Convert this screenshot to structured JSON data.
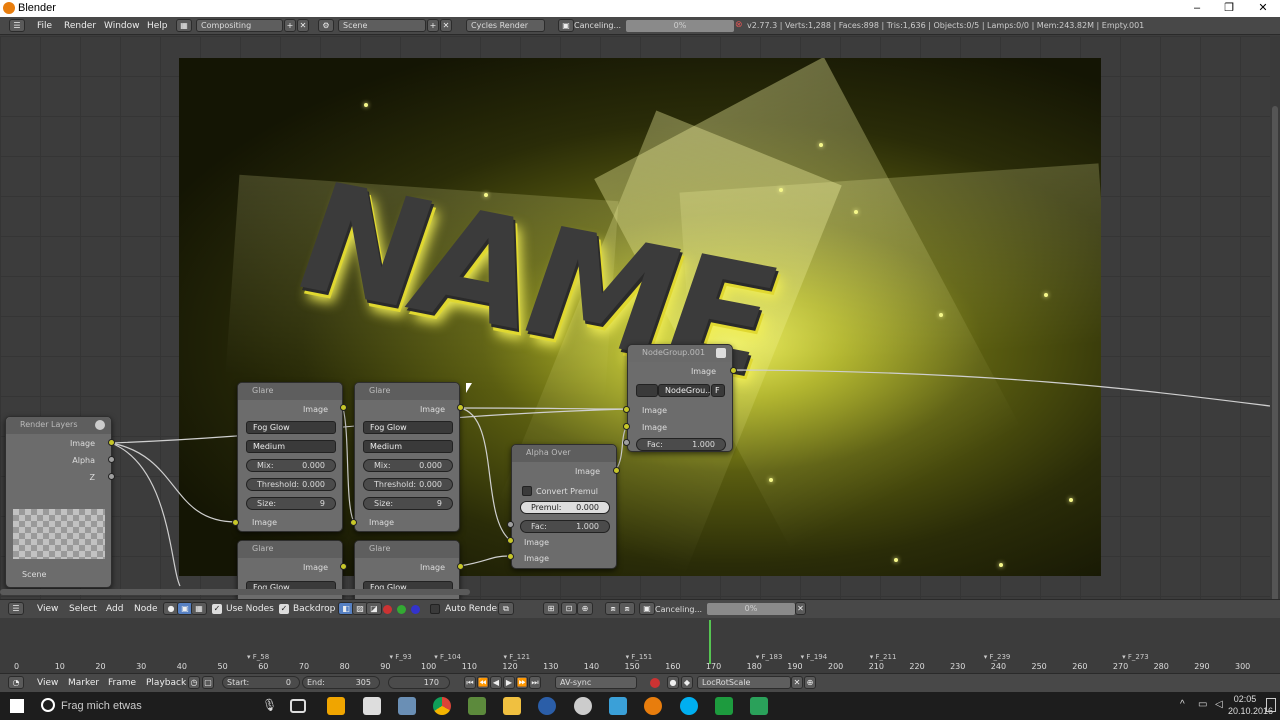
{
  "window": {
    "title": "Blender",
    "controls": [
      "–",
      "❐",
      "✕"
    ]
  },
  "info_header": {
    "menus": [
      "File",
      "Render",
      "Window",
      "Help"
    ],
    "screen_layout": "Compositing",
    "scene": "Scene",
    "engine": "Cycles Render",
    "job_label": "Canceling...",
    "progress_text": "0%",
    "progress_value": 0,
    "stats": "v2.77.3 | Verts:1,288 | Faces:898 | Tris:1,636 | Objects:0/5 | Lamps:0/0 | Mem:243.82M | Empty.001"
  },
  "backdrop": {
    "text": "NAME"
  },
  "nodes": {
    "render_layers": {
      "title": "Render Layers",
      "outputs": [
        "Image",
        "Alpha",
        "Z"
      ],
      "scene": "Scene"
    },
    "glare1": {
      "title": "Glare",
      "out": "Image",
      "type": "Fog Glow",
      "quality": "Medium",
      "mix_k": "Mix:",
      "mix_v": "0.000",
      "thr_k": "Threshold:",
      "thr_v": "0.000",
      "size_k": "Size:",
      "size_v": "9",
      "in": "Image"
    },
    "glare2": {
      "title": "Glare",
      "out": "Image",
      "type": "Fog Glow",
      "quality": "Medium",
      "mix_k": "Mix:",
      "mix_v": "0.000",
      "thr_k": "Threshold:",
      "thr_v": "0.000",
      "size_k": "Size:",
      "size_v": "9",
      "in": "Image"
    },
    "glare3": {
      "title": "Glare",
      "out": "Image",
      "type": "Fog Glow"
    },
    "glare4": {
      "title": "Glare",
      "out": "Image",
      "type": "Fog Glow"
    },
    "alpha_over": {
      "title": "Alpha Over",
      "out": "Image",
      "convert": "Convert Premul",
      "premul_k": "Premul:",
      "premul_v": "0.000",
      "fac_k": "Fac:",
      "fac_v": "1.000",
      "in1": "Image",
      "in2": "Image"
    },
    "nodegroup": {
      "title": "NodeGroup.001",
      "out": "Image",
      "group": "NodeGrou...",
      "fake": "F",
      "in1": "Image",
      "in2": "Image",
      "fac_k": "Fac:",
      "fac_v": "1.000"
    }
  },
  "node_header": {
    "menus": [
      "View",
      "Select",
      "Add",
      "Node"
    ],
    "use_nodes": "Use Nodes",
    "backdrop": "Backdrop",
    "auto_render": "Auto Render",
    "job_label": "Canceling...",
    "progress_text": "0%"
  },
  "timeline": {
    "ticks": [
      "0",
      "10",
      "20",
      "30",
      "40",
      "50",
      "60",
      "70",
      "80",
      "90",
      "100",
      "110",
      "120",
      "130",
      "140",
      "150",
      "160",
      "170",
      "180",
      "190",
      "200",
      "210",
      "220",
      "230",
      "240",
      "250",
      "260",
      "270",
      "280",
      "290",
      "300"
    ],
    "markers": [
      "F_58",
      "F_93",
      "F_104",
      "F_121",
      "F_151",
      "F_183",
      "F_194",
      "F_211",
      "F_239",
      "F_273"
    ],
    "current_frame": 170
  },
  "timeline_header": {
    "menus": [
      "View",
      "Marker",
      "Frame",
      "Playback"
    ],
    "start_k": "Start:",
    "start_v": "0",
    "end_k": "End:",
    "end_v": "305",
    "current": "170",
    "sync": "AV-sync",
    "keying_set": "LocRotScale"
  },
  "taskbar": {
    "search": "Frag mich etwas",
    "time": "02:05",
    "date": "20.10.2016"
  }
}
